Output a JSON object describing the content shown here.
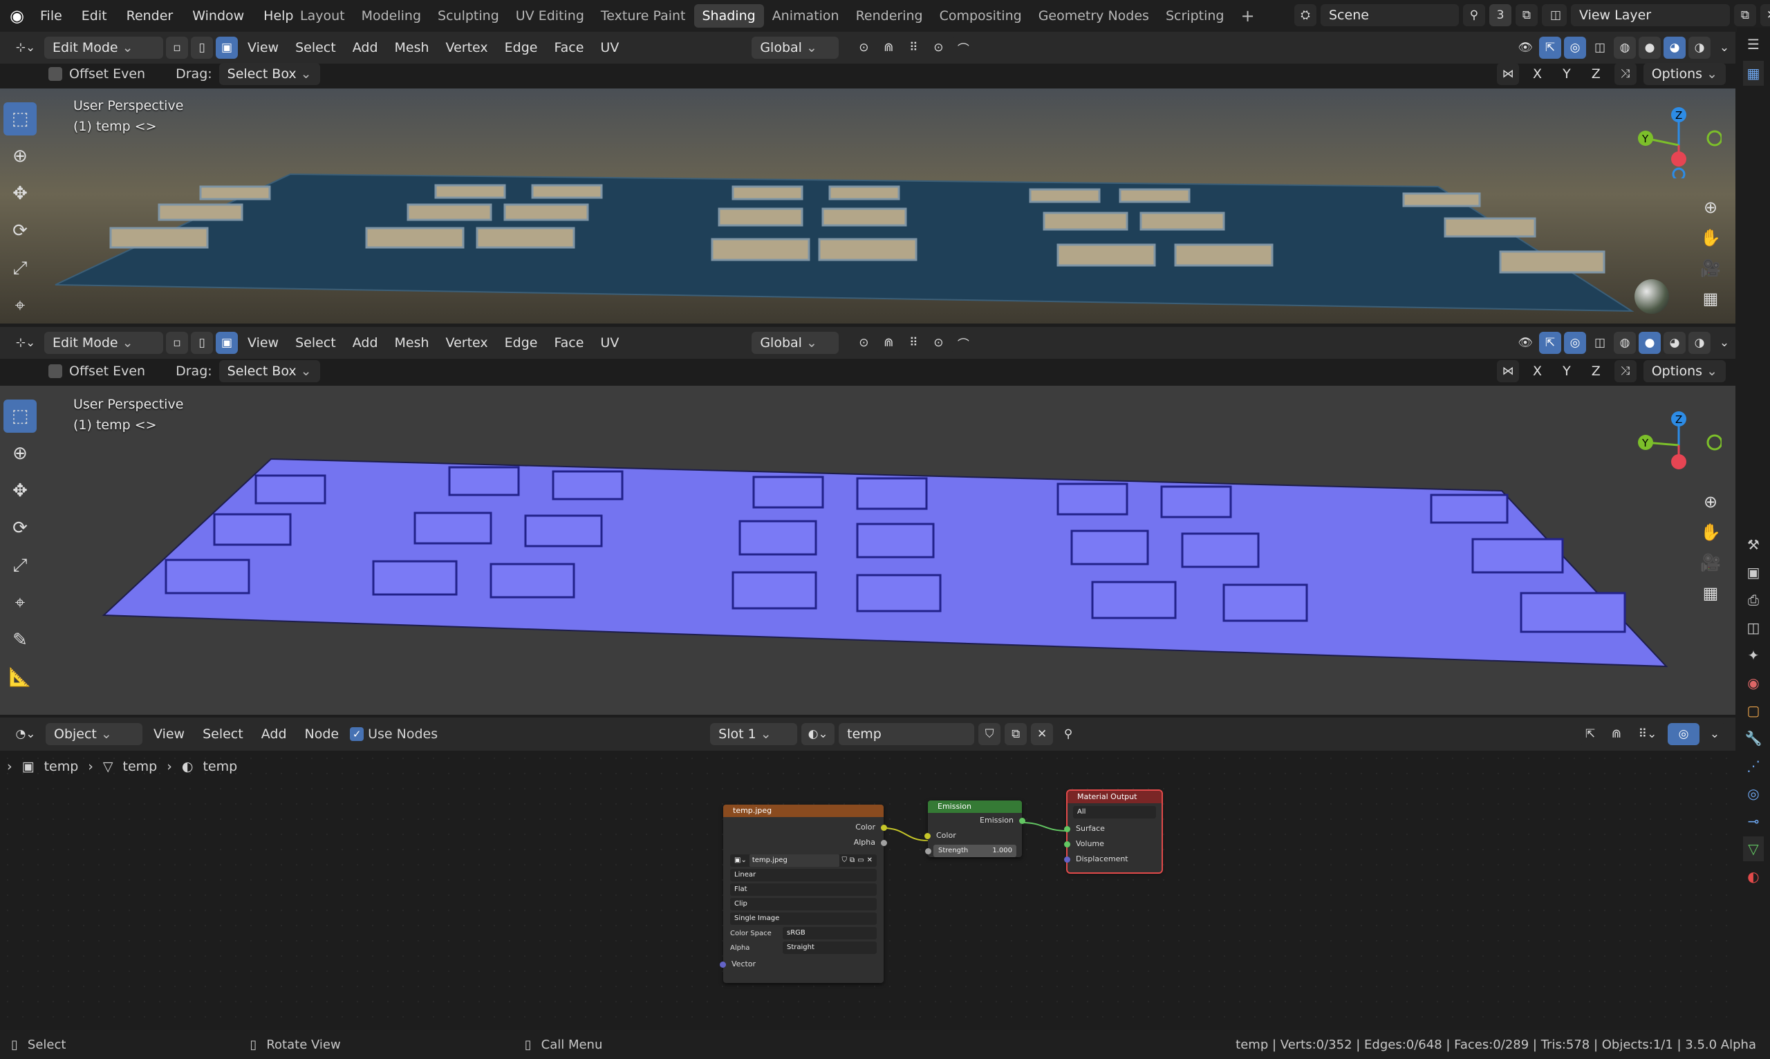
{
  "app": {
    "menus": [
      "File",
      "Edit",
      "Render",
      "Window",
      "Help"
    ],
    "workspaces": [
      "Layout",
      "Modeling",
      "Sculpting",
      "UV Editing",
      "Texture Paint",
      "Shading",
      "Animation",
      "Rendering",
      "Compositing",
      "Geometry Nodes",
      "Scripting"
    ],
    "active_workspace": "Shading",
    "scene_name": "Scene",
    "scene_users": "3",
    "view_layer": "View Layer"
  },
  "viewport_top": {
    "mode": "Edit Mode",
    "menus": [
      "View",
      "Select",
      "Add",
      "Mesh",
      "Vertex",
      "Edge",
      "Face",
      "UV"
    ],
    "transform_orientation": "Global",
    "offset_even": "Offset Even",
    "drag_label": "Drag:",
    "drag_value": "Select Box",
    "axes": [
      "X",
      "Y",
      "Z"
    ],
    "options": "Options",
    "view_name": "User Perspective",
    "object_info": "(1) temp <>"
  },
  "viewport_bottom": {
    "mode": "Edit Mode",
    "menus": [
      "View",
      "Select",
      "Add",
      "Mesh",
      "Vertex",
      "Edge",
      "Face",
      "UV"
    ],
    "transform_orientation": "Global",
    "offset_even": "Offset Even",
    "drag_label": "Drag:",
    "drag_value": "Select Box",
    "axes": [
      "X",
      "Y",
      "Z"
    ],
    "options": "Options",
    "view_name": "User Perspective",
    "object_info": "(1) temp <>"
  },
  "node_editor": {
    "object_mode": "Object",
    "menus": [
      "View",
      "Select",
      "Add",
      "Node"
    ],
    "use_nodes": "Use Nodes",
    "slot": "Slot 1",
    "material": "temp",
    "breadcrumb": [
      "temp",
      "temp",
      "temp"
    ],
    "image_node": {
      "title": "temp.jpeg",
      "out_color": "Color",
      "out_alpha": "Alpha",
      "image": "temp.jpeg",
      "interpolation": "Linear",
      "projection": "Flat",
      "extension": "Clip",
      "source": "Single Image",
      "color_space_label": "Color Space",
      "color_space": "sRGB",
      "alpha_label": "Alpha",
      "alpha": "Straight",
      "in_vector": "Vector"
    },
    "emission_node": {
      "title": "Emission",
      "out_emission": "Emission",
      "in_color": "Color",
      "strength_label": "Strength",
      "strength": "1.000"
    },
    "output_node": {
      "title": "Material Output",
      "target": "All",
      "in_surface": "Surface",
      "in_volume": "Volume",
      "in_displacement": "Displacement"
    }
  },
  "statusbar": {
    "hint_left": "Select",
    "hint_mid": "Rotate View",
    "hint_right": "Call Menu",
    "stats": "temp | Verts:0/352 | Edges:0/648 | Faces:0/289 | Tris:578 | Objects:1/1 | 3.5.0 Alpha"
  },
  "colors": {
    "accent": "#4772b3",
    "mesh_face": "#7474f0",
    "image_node_header": "#8a4b1f",
    "emission_node_header": "#357a35",
    "output_node_header": "#7a2626",
    "socket_color": "#c7c729",
    "socket_shader": "#63c763",
    "socket_vector": "#6363c7",
    "axis_x": "#e64553",
    "axis_y": "#7cbf2a",
    "axis_z": "#2d8ce6"
  }
}
